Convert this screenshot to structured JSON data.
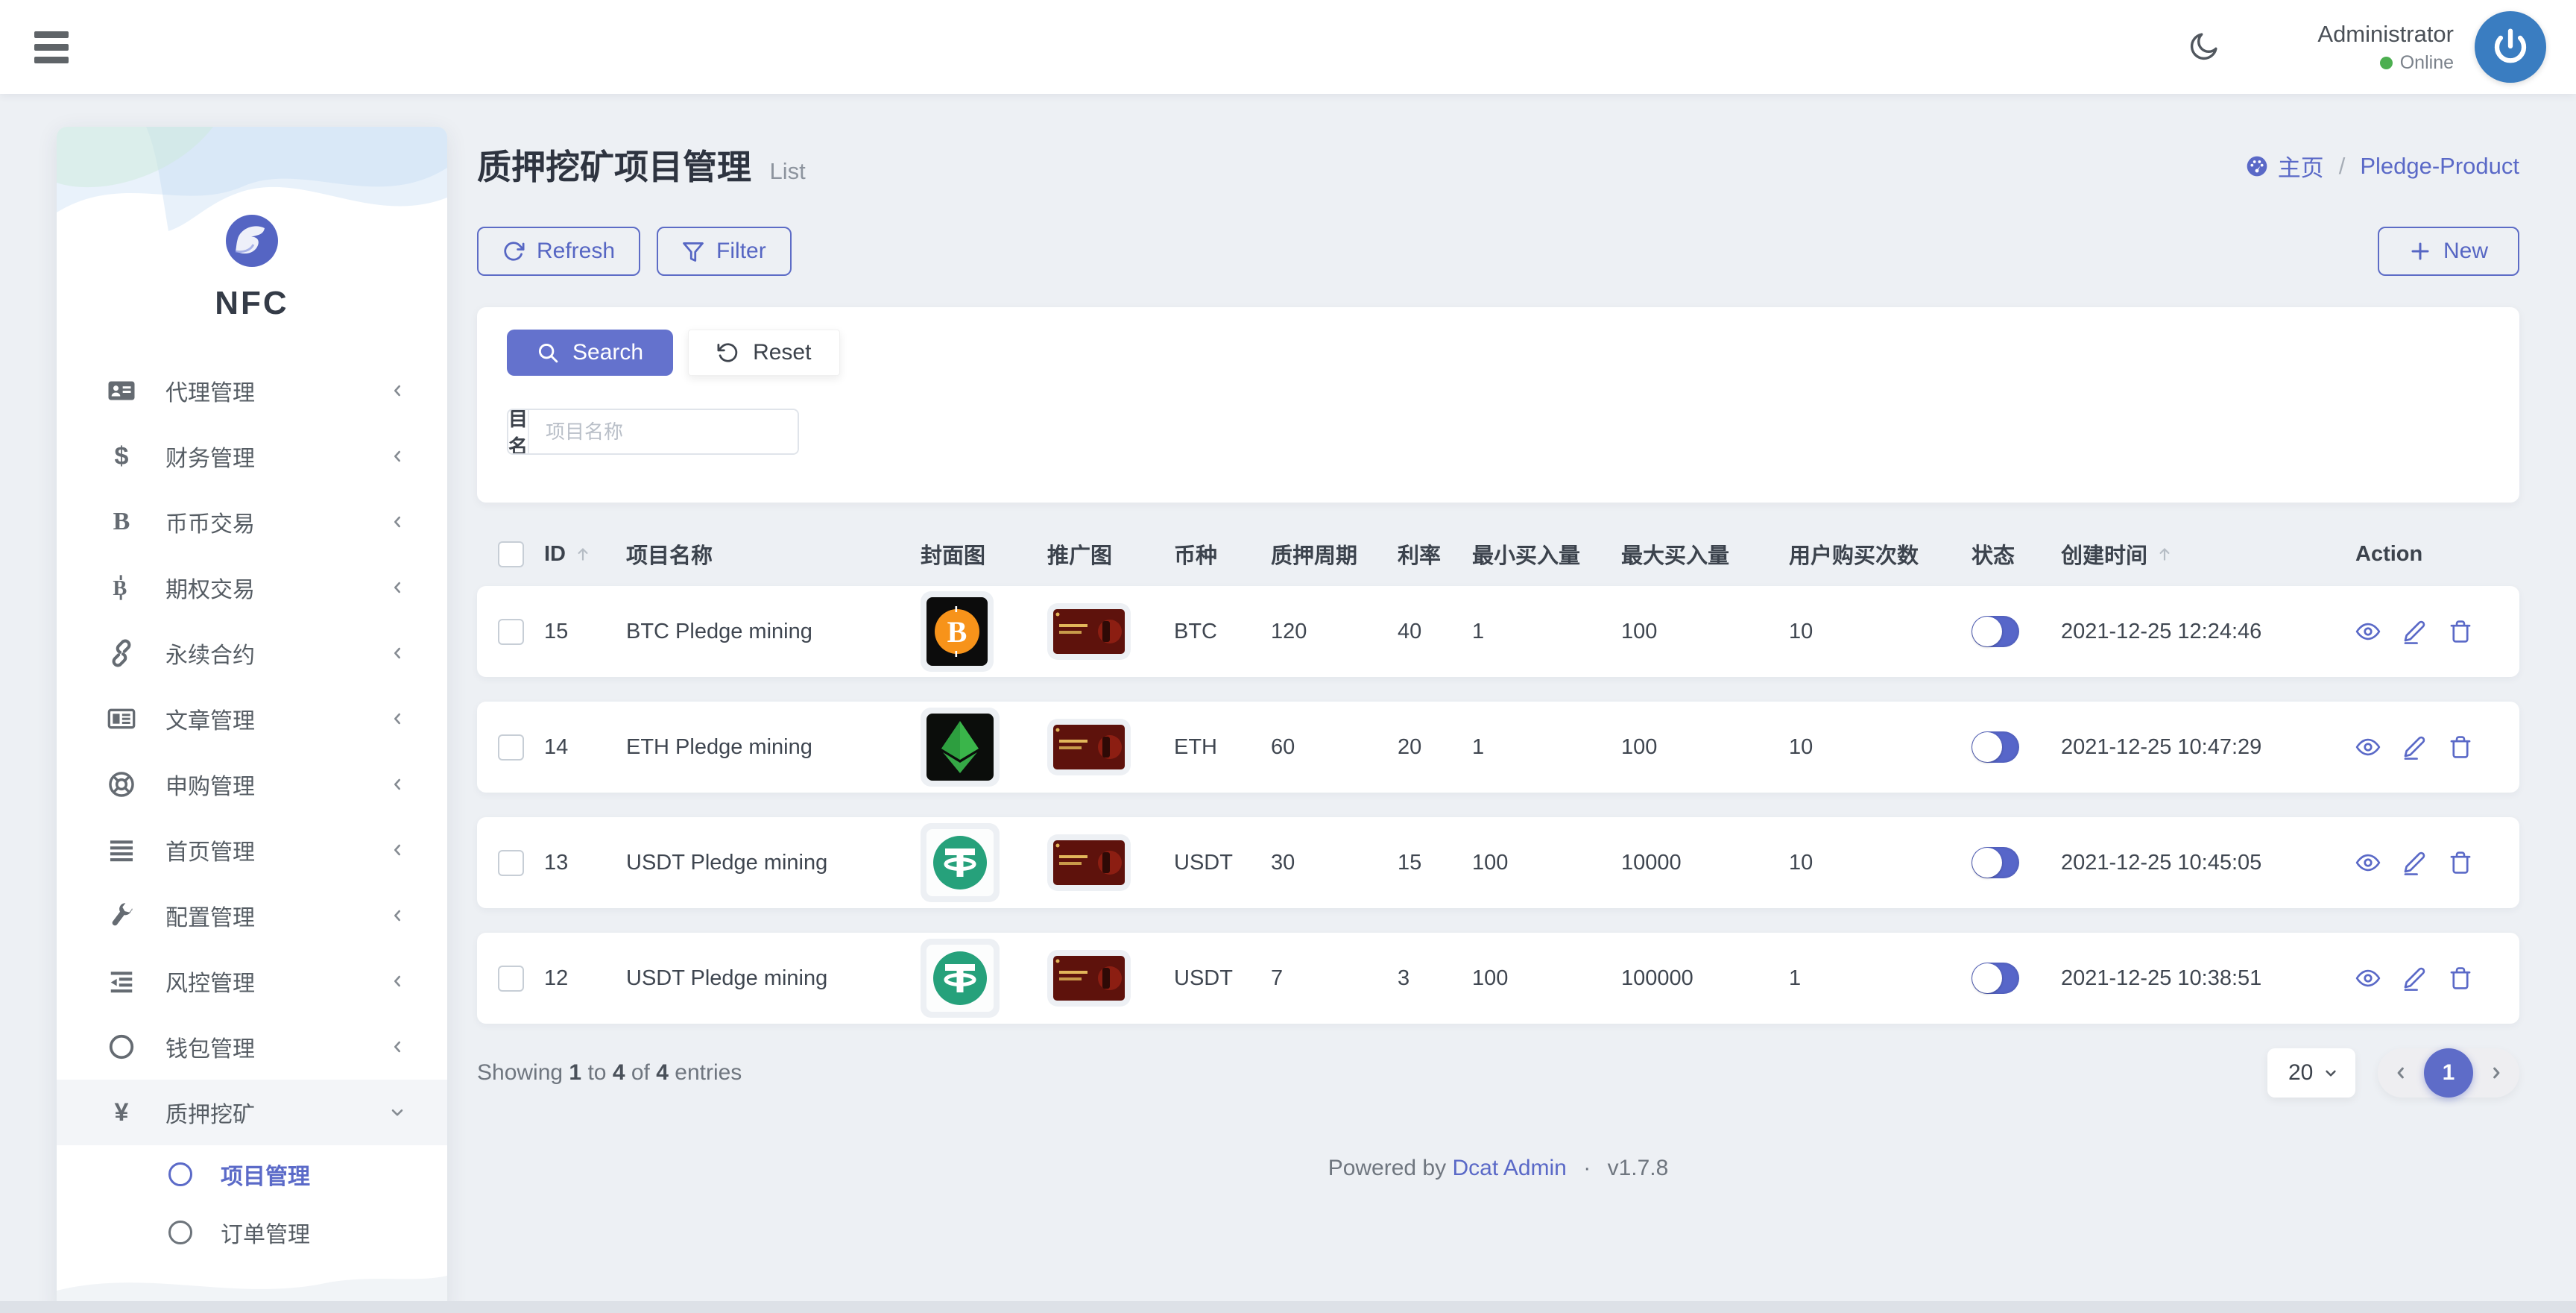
{
  "topbar": {
    "user_name": "Administrator",
    "user_status": "Online"
  },
  "sidebar": {
    "brand": "NFC",
    "items": [
      {
        "label": "代理管理",
        "icon": "id-card-icon",
        "state": "collapsed"
      },
      {
        "label": "财务管理",
        "icon": "dollar-icon",
        "state": "collapsed"
      },
      {
        "label": "币币交易",
        "icon": "coin-b-icon",
        "state": "collapsed"
      },
      {
        "label": "期权交易",
        "icon": "baht-icon",
        "state": "collapsed"
      },
      {
        "label": "永续合约",
        "icon": "link-icon",
        "state": "collapsed"
      },
      {
        "label": "文章管理",
        "icon": "newspaper-icon",
        "state": "collapsed"
      },
      {
        "label": "申购管理",
        "icon": "life-ring-icon",
        "state": "collapsed"
      },
      {
        "label": "首页管理",
        "icon": "align-justify-icon",
        "state": "collapsed"
      },
      {
        "label": "配置管理",
        "icon": "wrench-icon",
        "state": "collapsed"
      },
      {
        "label": "风控管理",
        "icon": "indent-icon",
        "state": "collapsed"
      },
      {
        "label": "钱包管理",
        "icon": "circle-icon",
        "state": "collapsed"
      },
      {
        "label": "质押挖矿",
        "icon": "yen-icon",
        "state": "expanded",
        "children": [
          {
            "label": "项目管理",
            "active": true
          },
          {
            "label": "订单管理",
            "active": false
          }
        ]
      }
    ]
  },
  "page": {
    "title": "质押挖矿项目管理",
    "subtitle": "List",
    "breadcrumb": {
      "home": "主页",
      "separator": "/",
      "current": "Pledge-Product"
    },
    "toolbar": {
      "refresh": "Refresh",
      "filter": "Filter",
      "new": "New"
    }
  },
  "search_panel": {
    "search": "Search",
    "reset": "Reset",
    "field_label": "项目名称",
    "field_placeholder": "项目名称"
  },
  "table": {
    "headers": [
      "ID",
      "项目名称",
      "封面图",
      "推广图",
      "币种",
      "质押周期",
      "利率",
      "最小买入量",
      "最大买入量",
      "用户购买次数",
      "状态",
      "创建时间",
      "Action"
    ],
    "sorted_columns": [
      "ID",
      "创建时间"
    ],
    "rows": [
      {
        "id": "15",
        "name": "BTC Pledge mining",
        "cover_icon": "btc-coin-image",
        "promo_icon": "red-banner-image",
        "coin": "BTC",
        "period": "120",
        "rate": "40",
        "min_buy": "1",
        "max_buy": "100",
        "buy_times": "10",
        "status": "on",
        "created_at": "2021-12-25 12:24:46"
      },
      {
        "id": "14",
        "name": "ETH Pledge mining",
        "cover_icon": "eth-coin-image",
        "promo_icon": "red-banner-image",
        "coin": "ETH",
        "period": "60",
        "rate": "20",
        "min_buy": "1",
        "max_buy": "100",
        "buy_times": "10",
        "status": "on",
        "created_at": "2021-12-25 10:47:29"
      },
      {
        "id": "13",
        "name": "USDT Pledge mining",
        "cover_icon": "usdt-coin-image",
        "promo_icon": "red-banner-image",
        "coin": "USDT",
        "period": "30",
        "rate": "15",
        "min_buy": "100",
        "max_buy": "10000",
        "buy_times": "10",
        "status": "on",
        "created_at": "2021-12-25 10:45:05"
      },
      {
        "id": "12",
        "name": "USDT Pledge mining",
        "cover_icon": "usdt-coin-image",
        "promo_icon": "red-banner-image",
        "coin": "USDT",
        "period": "7",
        "rate": "3",
        "min_buy": "100",
        "max_buy": "100000",
        "buy_times": "1",
        "status": "on",
        "created_at": "2021-12-25 10:38:51"
      }
    ]
  },
  "pagination": {
    "summary": {
      "prefix": "Showing",
      "from": "1",
      "mid": "to",
      "to": "4",
      "of": "of",
      "total": "4",
      "suffix": "entries"
    },
    "page_size": "20",
    "current_page": "1"
  },
  "footer": {
    "powered": "Powered by",
    "brand": "Dcat Admin",
    "separator": "·",
    "version": "v1.7.8"
  },
  "colors": {
    "primary": "#5e6cc8",
    "link": "#5a69c7",
    "online": "#4caf50",
    "avatar_bg": "#3a7dc1",
    "page_bg": "#edf0f4",
    "toggle_on": "#5766c9"
  }
}
